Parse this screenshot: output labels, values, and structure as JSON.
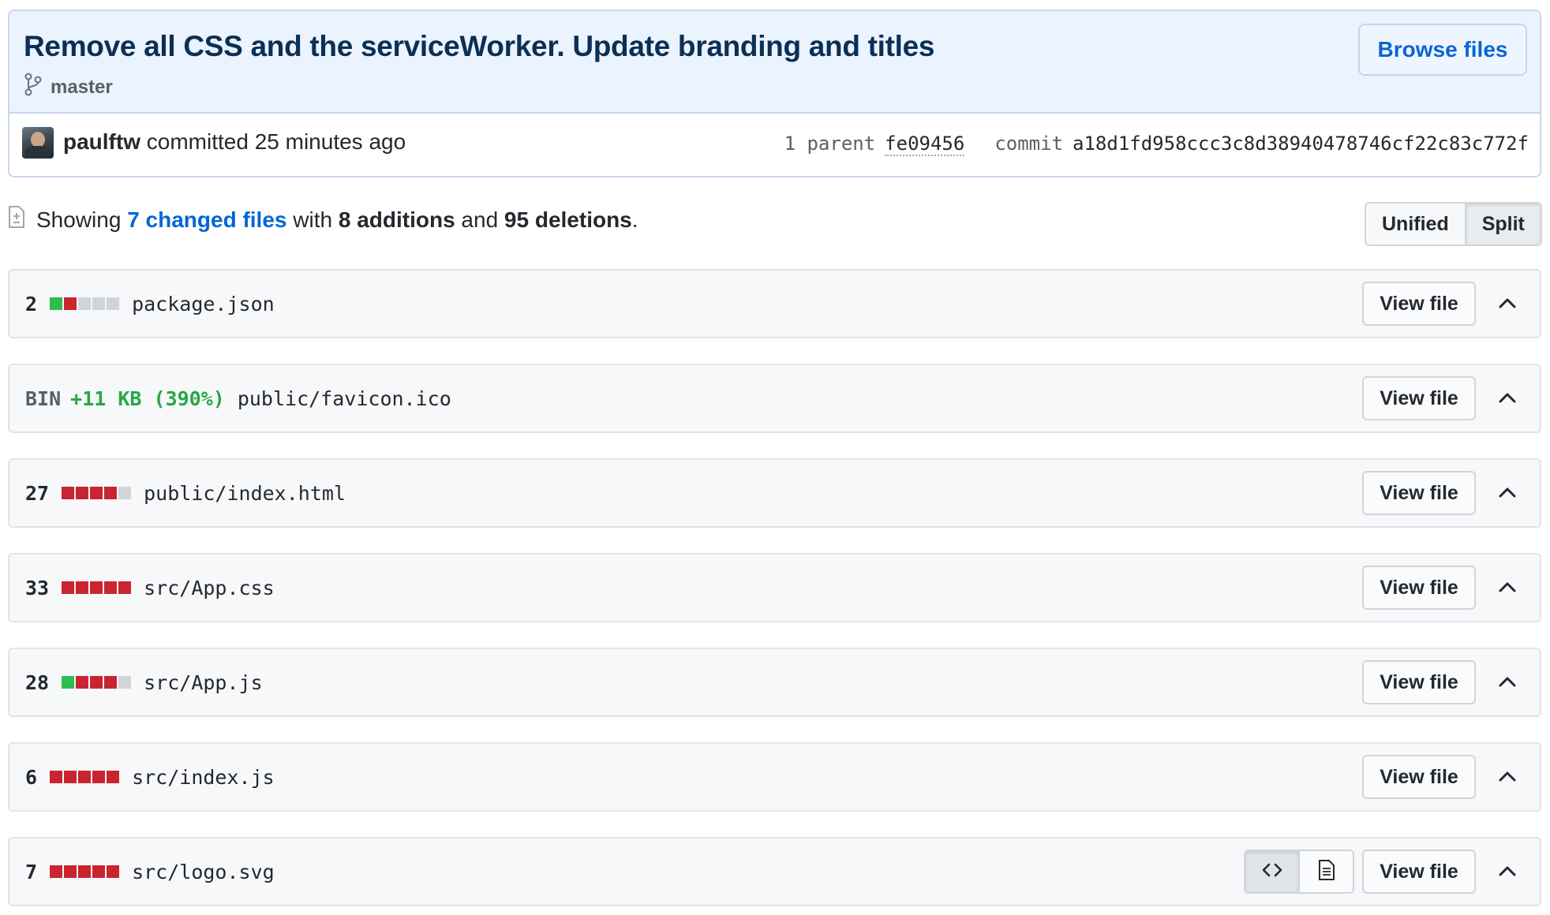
{
  "commit": {
    "title": "Remove all CSS and the serviceWorker. Update branding and titles",
    "branch": "master",
    "browse_label": "Browse files",
    "author": "paulftw",
    "action": "committed 25 minutes ago",
    "parent_label": "1 parent",
    "parent_sha": "fe09456",
    "commit_label": "commit",
    "commit_sha": "a18d1fd958ccc3c8d38940478746cf22c83c772f"
  },
  "summary": {
    "prefix": "Showing",
    "changed": "7 changed files",
    "with": "with",
    "additions": "8 additions",
    "and": "and",
    "deletions": "95 deletions",
    "period": "."
  },
  "view_mode": {
    "unified": "Unified",
    "split": "Split",
    "selected": "Split"
  },
  "files": [
    {
      "count": "2",
      "path": "package.json",
      "stat": [
        "add",
        "del",
        "neu",
        "neu",
        "neu"
      ],
      "view_label": "View file"
    },
    {
      "bin": "BIN",
      "delta": "+11 KB (390%)",
      "path": "public/favicon.ico",
      "view_label": "View file"
    },
    {
      "count": "27",
      "path": "public/index.html",
      "stat": [
        "del",
        "del",
        "del",
        "del",
        "neu"
      ],
      "view_label": "View file"
    },
    {
      "count": "33",
      "path": "src/App.css",
      "stat": [
        "del",
        "del",
        "del",
        "del",
        "del"
      ],
      "view_label": "View file"
    },
    {
      "count": "28",
      "path": "src/App.js",
      "stat": [
        "add",
        "del",
        "del",
        "del",
        "neu"
      ],
      "view_label": "View file"
    },
    {
      "count": "6",
      "path": "src/index.js",
      "stat": [
        "del",
        "del",
        "del",
        "del",
        "del"
      ],
      "view_label": "View file"
    },
    {
      "count": "7",
      "path": "src/logo.svg",
      "stat": [
        "del",
        "del",
        "del",
        "del",
        "del"
      ],
      "view_label": "View file",
      "has_view_toggle": true
    }
  ],
  "colors": {
    "addition": "#2cbe4e",
    "deletion": "#cb2431",
    "neutral": "#d1d5da",
    "link": "#0366d6"
  }
}
